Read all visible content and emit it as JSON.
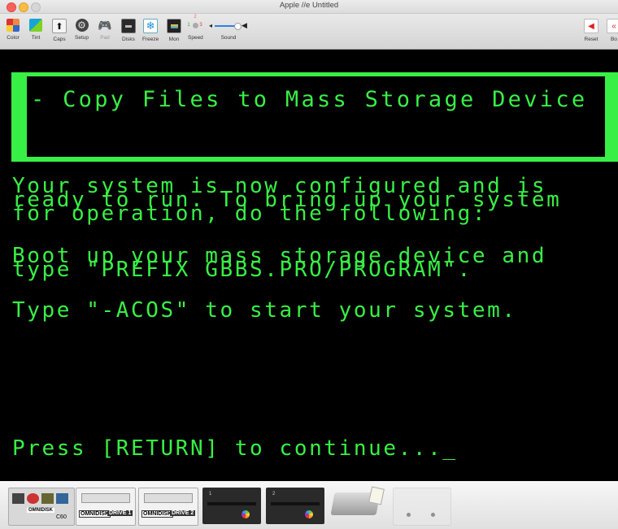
{
  "window": {
    "title": "Apple //e  Untitled",
    "traffic_lights": [
      "#fc605c",
      "#fdbc40",
      "#34c84a"
    ]
  },
  "toolbar": {
    "items": [
      {
        "label": "Color",
        "icon": "color-icon"
      },
      {
        "label": "Tint",
        "icon": "tint-icon"
      },
      {
        "label": "Caps",
        "icon": "caps-icon"
      },
      {
        "label": "Setup",
        "icon": "setup-icon"
      },
      {
        "label": "Pad",
        "icon": "gamepad-icon"
      },
      {
        "label": "Disks",
        "icon": "disks-icon"
      },
      {
        "label": "Freeze",
        "icon": "freeze-icon"
      },
      {
        "label": "Mon",
        "icon": "monitor-icon"
      },
      {
        "label": "Speed",
        "icon": "speed-icon"
      },
      {
        "label": "Sound",
        "icon": "sound-slider-icon"
      },
      {
        "label": "Reset",
        "icon": "reset-icon"
      },
      {
        "label": "Bo",
        "icon": "boot-icon"
      }
    ],
    "speed_digits": [
      "2",
      "1",
      "3"
    ]
  },
  "screen": {
    "banner": "- Copy Files to Mass Storage Device -",
    "lines": [
      "Your system is now configured and is",
      "ready to run. To bring up your system",
      "for operation, do the following:",
      "Boot up your mass storage device and",
      "type \"PREFIX GBBS.PRO/PROGRAM\".",
      "Type \"-ACOS\" to start your system.",
      "Press [RETURN] to continue..._"
    ],
    "text_color": "#38f045"
  },
  "shelf": {
    "drive1_label": "DRIVE 1",
    "drive2_label": "DRIVE 2",
    "omnidisk": "OMNIDISK",
    "c60": "C60",
    "slot_labels": [
      "1",
      "2"
    ]
  }
}
